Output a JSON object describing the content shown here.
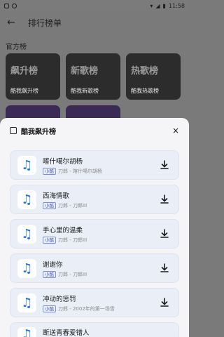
{
  "status": {
    "time": "11:58"
  },
  "header": {
    "title": "排行榜单",
    "back_icon": "arrow-left-icon"
  },
  "section": {
    "label": "官方榜"
  },
  "cards": [
    {
      "title": "飙升榜",
      "subtitle": "酷我飙升榜"
    },
    {
      "title": "新歌榜",
      "subtitle": "酷我新歌榜"
    },
    {
      "title": "热歌榜",
      "subtitle": "酷我热歌榜"
    }
  ],
  "sheet": {
    "title": "酷我飙升榜",
    "close": "×"
  },
  "songs": [
    {
      "name": "喀什噶尔胡杨",
      "badge": "小酷",
      "artist": "刀郎 - 喀什噶尔胡杨"
    },
    {
      "name": "西海情歌",
      "badge": "小酷",
      "artist": "刀郎 - 刀郎III"
    },
    {
      "name": "手心里的温柔",
      "badge": "小酷",
      "artist": "刀郎 - 刀郎III"
    },
    {
      "name": "谢谢你",
      "badge": "小酷",
      "artist": "刀郎 - 刀郎III"
    },
    {
      "name": "冲动的惩罚",
      "badge": "小酷",
      "artist": "刀郎 - 2002年的第一场雪"
    },
    {
      "name": "断送青春爱错人",
      "badge": "",
      "artist": ""
    }
  ]
}
